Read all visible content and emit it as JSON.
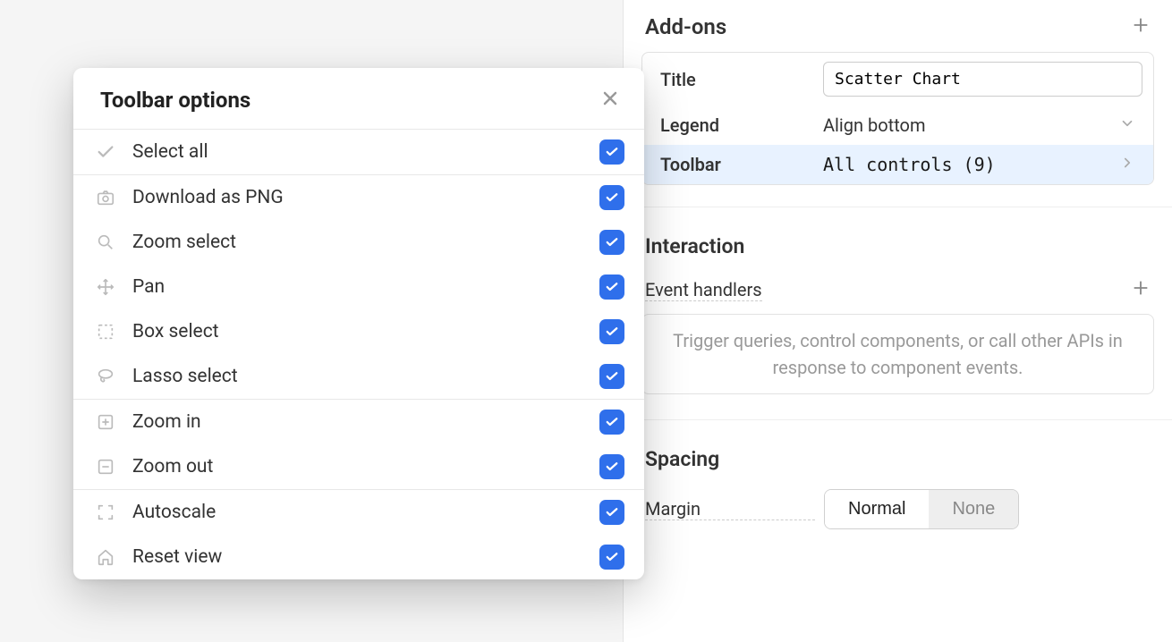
{
  "right_panel": {
    "addons_title": "Add-ons",
    "title_label": "Title",
    "title_value": "Scatter Chart",
    "legend_label": "Legend",
    "legend_value": "Align bottom",
    "toolbar_label": "Toolbar",
    "toolbar_value": "All controls (9)",
    "interaction_title": "Interaction",
    "event_handlers_label": "Event handlers",
    "event_placeholder": "Trigger queries, control components, or call other APIs in response to component events.",
    "spacing_title": "Spacing",
    "margin_label": "Margin",
    "margin_normal": "Normal",
    "margin_none": "None"
  },
  "modal": {
    "title": "Toolbar options",
    "select_all": "Select all",
    "groups": [
      [
        {
          "icon": "camera",
          "label": "Download as PNG"
        },
        {
          "icon": "zoomin",
          "label": "Zoom select"
        },
        {
          "icon": "pan",
          "label": "Pan"
        },
        {
          "icon": "boxsel",
          "label": "Box select"
        },
        {
          "icon": "lasso",
          "label": "Lasso select"
        }
      ],
      [
        {
          "icon": "plusbox",
          "label": "Zoom in"
        },
        {
          "icon": "minusbox",
          "label": "Zoom out"
        }
      ],
      [
        {
          "icon": "auto",
          "label": "Autoscale"
        },
        {
          "icon": "home",
          "label": "Reset view"
        }
      ]
    ]
  }
}
